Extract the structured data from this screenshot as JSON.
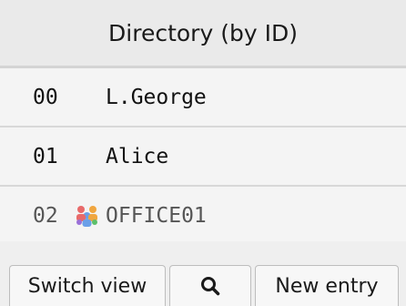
{
  "header": {
    "title": "Directory (by ID)"
  },
  "entries": [
    {
      "id": "00",
      "name": "L.George",
      "is_group": false
    },
    {
      "id": "01",
      "name": "Alice",
      "is_group": false
    },
    {
      "id": "02",
      "name": "OFFICE01",
      "is_group": true,
      "icon": "group-icon"
    }
  ],
  "toolbar": {
    "switch_view_label": "Switch view",
    "search_icon": "search-icon",
    "new_entry_label": "New entry"
  },
  "colors": {
    "background": "#efefef",
    "divider": "#d4d4d4",
    "button_border": "#bdbdbd"
  }
}
